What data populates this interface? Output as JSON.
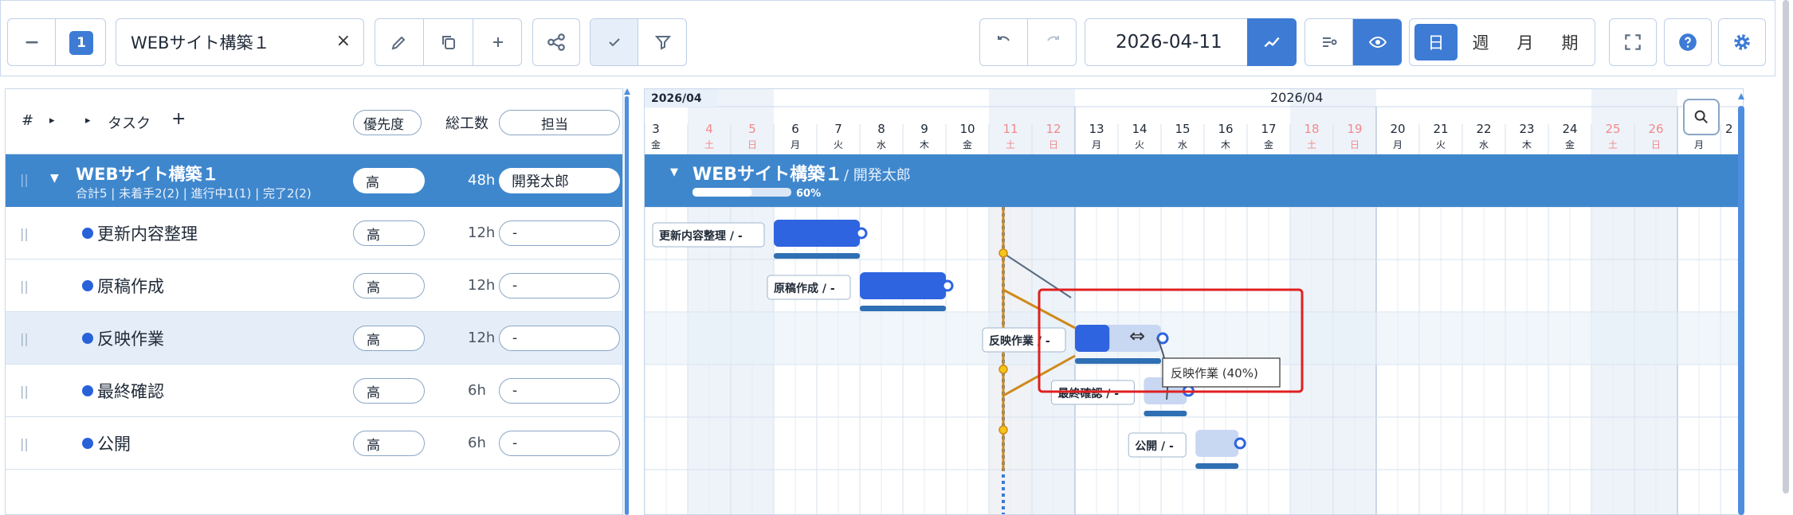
{
  "toolbar": {
    "page_number": "1",
    "project_name": "WEBサイト構築１",
    "clear_label": "×",
    "date": "2026-04-11",
    "scale_day": "日",
    "scale_week": "週",
    "scale_month": "月",
    "scale_period": "期"
  },
  "task_header": {
    "col_no": "#",
    "col_task": "タスク",
    "add": "+",
    "col_priority": "優先度",
    "col_hours": "総工数",
    "col_assignee": "担当"
  },
  "project_row": {
    "name": "WEBサイト構築１",
    "summary": "合計5 | 未着手2(2) | 進行中1(1) | 完了2(2)",
    "priority": "高",
    "hours": "48h",
    "assignee": "開発太郎",
    "bar_title": "WEBサイト構築１",
    "bar_owner": "/ 開発太郎",
    "progress_label": "60%",
    "progress": 0.6
  },
  "tasks": [
    {
      "name": "更新内容整理",
      "priority": "高",
      "hours": "12h",
      "assignee": "-",
      "bar_label": "更新内容整理 / -"
    },
    {
      "name": "原稿作成",
      "priority": "高",
      "hours": "12h",
      "assignee": "-",
      "bar_label": "原稿作成 / -"
    },
    {
      "name": "反映作業",
      "priority": "高",
      "hours": "12h",
      "assignee": "-",
      "bar_label": "反映作業 / -"
    },
    {
      "name": "最終確認",
      "priority": "高",
      "hours": "6h",
      "assignee": "-",
      "bar_label": "最終確認 / -"
    },
    {
      "name": "公開",
      "priority": "高",
      "hours": "6h",
      "assignee": "-",
      "bar_label": "公開 / -"
    }
  ],
  "timeline": {
    "month_small": "2026/04",
    "month_center": "2026/04",
    "days": [
      {
        "d": "3",
        "w": "金",
        "we": false
      },
      {
        "d": "4",
        "w": "土",
        "we": true
      },
      {
        "d": "5",
        "w": "日",
        "we": true
      },
      {
        "d": "6",
        "w": "月",
        "we": false
      },
      {
        "d": "7",
        "w": "火",
        "we": false
      },
      {
        "d": "8",
        "w": "水",
        "we": false
      },
      {
        "d": "9",
        "w": "木",
        "we": false
      },
      {
        "d": "10",
        "w": "金",
        "we": false
      },
      {
        "d": "11",
        "w": "土",
        "we": true
      },
      {
        "d": "12",
        "w": "日",
        "we": true
      },
      {
        "d": "13",
        "w": "月",
        "we": false
      },
      {
        "d": "14",
        "w": "火",
        "we": false
      },
      {
        "d": "15",
        "w": "水",
        "we": false
      },
      {
        "d": "16",
        "w": "木",
        "we": false
      },
      {
        "d": "17",
        "w": "金",
        "we": false
      },
      {
        "d": "18",
        "w": "土",
        "we": true
      },
      {
        "d": "19",
        "w": "日",
        "we": true
      },
      {
        "d": "20",
        "w": "月",
        "we": false
      },
      {
        "d": "21",
        "w": "火",
        "we": false
      },
      {
        "d": "22",
        "w": "水",
        "we": false
      },
      {
        "d": "23",
        "w": "木",
        "we": false
      },
      {
        "d": "24",
        "w": "金",
        "we": false
      },
      {
        "d": "25",
        "w": "土",
        "we": true
      },
      {
        "d": "26",
        "w": "日",
        "we": true
      },
      {
        "d": "",
        "w": "月",
        "we": false
      }
    ],
    "cut_label": "2"
  },
  "tooltip": "反映作業 (40%)",
  "colors": {
    "accent": "#3d7bd5",
    "project_bar": "#3f87cd",
    "task_bar": "#2f64e0",
    "weekend_text": "#f08a8a",
    "dependency": "#cf8a1a",
    "highlight": "#e02020"
  }
}
